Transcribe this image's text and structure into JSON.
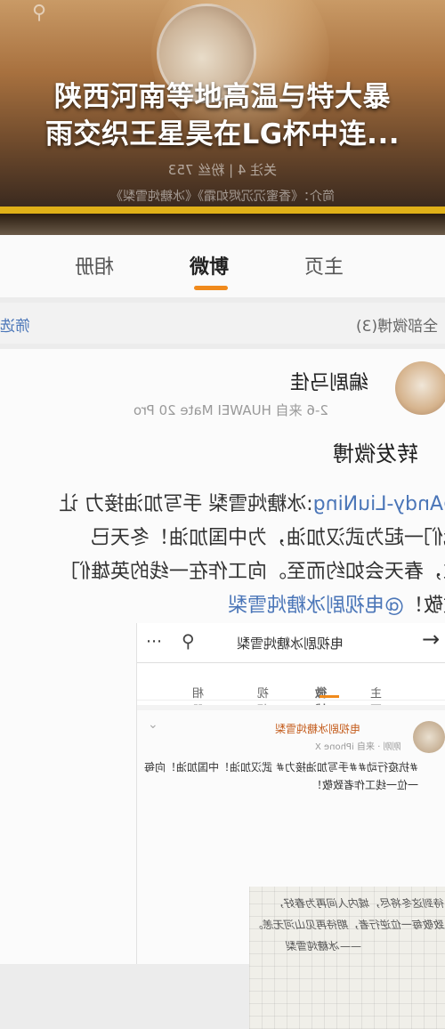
{
  "banner": {
    "headline_line1": "陕西河南等地高温与特大暴",
    "headline_line2": "雨交织王星昊在LG杯中连...",
    "stats": "关注 4  |  粉丝 753",
    "intro": "简介：《香蜜沉沉烬如霜》《冰糖炖雪梨》"
  },
  "tabs": {
    "photos": "相册",
    "weibo": "微博",
    "home": "主页"
  },
  "filter": {
    "all_label": "全部微博(3)",
    "filter_label": "筛选"
  },
  "post": {
    "author": "编剧马佳",
    "meta": "2-6  来自 HUAWEI Mate 20 Pro",
    "repost_label": "转发微博",
    "line1_mention": "@Andy-LiuNing",
    "line1_text": ":冰糖炖雪梨 手写加油接力 让",
    "line2": "我们一起为武汉加油，为中国加油！冬天已",
    "line3": "过，春天会如约而至。向工作在一线的英雄们",
    "line4_text": "致敬！",
    "line4_mention": "@电视剧冰糖炖雪梨"
  },
  "embedded": {
    "title": "电视剧冰糖炖雪梨",
    "tabs": {
      "home": "主页",
      "weibo": "微博",
      "video": "视频",
      "photos": "相册"
    },
    "author": "电视剧冰糖炖雪梨",
    "meta": "刚刚 · 来自 iPhone X",
    "text_line1": "#抗疫行动##手写加油接力# 武汉加油！中国加油！向每",
    "text_line2": "一位一线工作者致敬！",
    "handwriting": [
      "待到这冬将尽，城内人间再为春好，",
      "致敬每一位逆行者，期待再见山河无恙。",
      "——冰糖炖雪梨"
    ]
  },
  "colors": {
    "accent": "#f08a1c",
    "link": "#4b76b8",
    "gold_bar": "#e0b018"
  }
}
